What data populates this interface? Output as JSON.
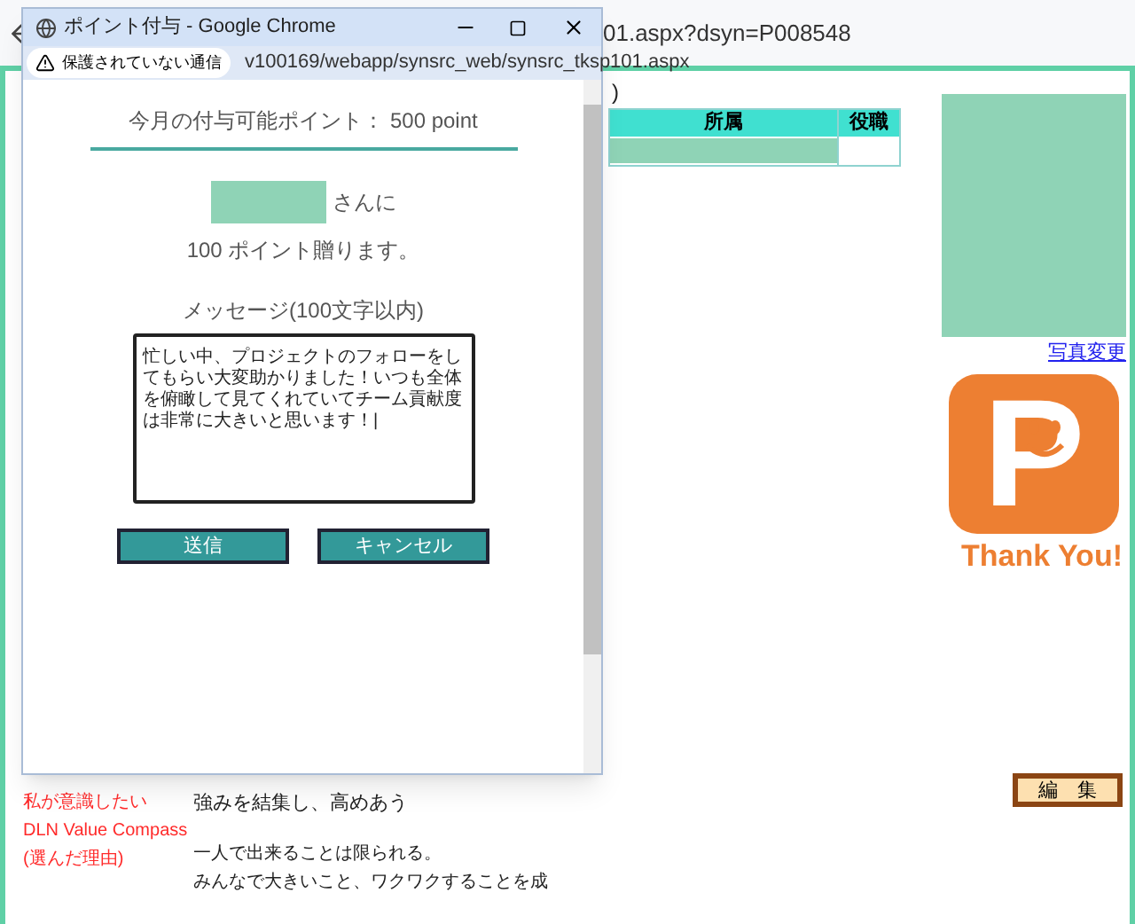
{
  "browser": {
    "url_fragment": "01.aspx?dsyn=P008548"
  },
  "page": {
    "header_fragment": ")",
    "table": {
      "columns": [
        "所属",
        "役職"
      ]
    },
    "photo_link": "写真変更",
    "logo": {
      "letter": "P",
      "caption": "Thank You!"
    },
    "edit_button": "編　集",
    "compass": {
      "labels": [
        "私が意識したい",
        "DLN Value Compass",
        "(選んだ理由)"
      ],
      "value": "強みを結集し、高めあう",
      "reason_lines": [
        "一人で出来ることは限られる。",
        "みんなで大きいこと、ワクワクすることを成"
      ]
    }
  },
  "popup": {
    "title": "ポイント付与 - Google Chrome",
    "security": "保護されていない通信",
    "url": "v100169/webapp/synsrc_web/synsrc_tksp101.aspx",
    "available": "今月の付与可能ポイント： 500 point",
    "recipient_suffix": "さんに",
    "amount_text": "100 ポイント贈ります。",
    "message_label": "メッセージ(100文字以内)",
    "message": "忙しい中、プロジェクトのフォローをしてもらい大変助かりました！いつも全体を俯瞰して見てくれていてチーム貢献度は非常に大きいと思います！|",
    "buttons": [
      "送信",
      "キャンセル"
    ]
  }
}
